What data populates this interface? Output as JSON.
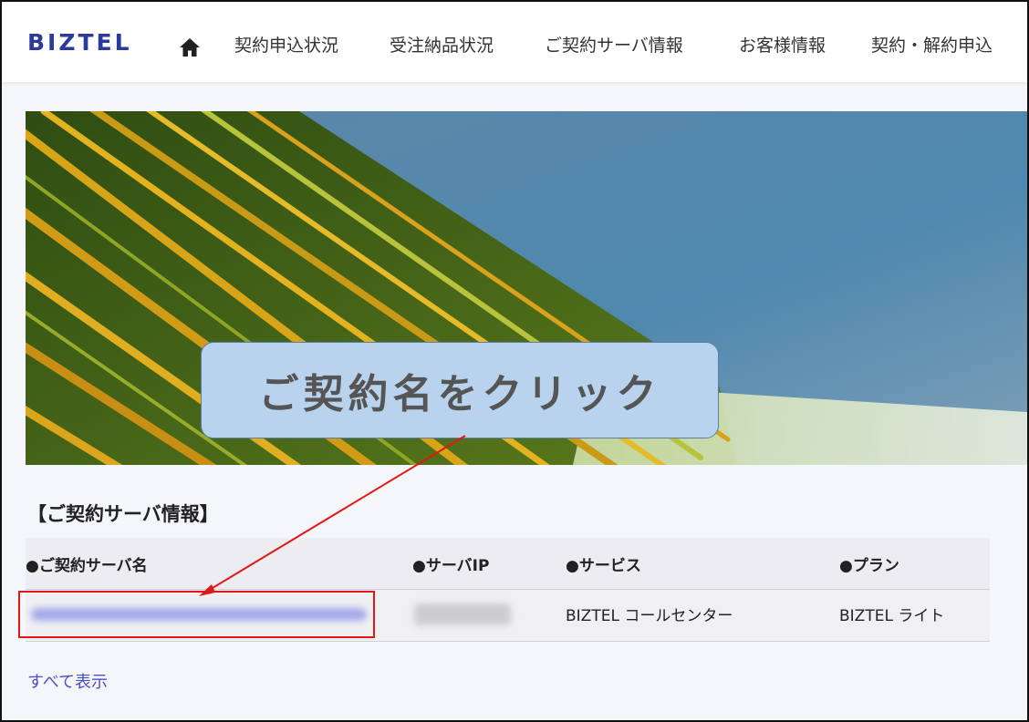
{
  "brand": {
    "logo": "BIZTEL",
    "accent_color": "#2b3a9c"
  },
  "nav": {
    "home_icon": "home-icon",
    "items": [
      {
        "label": "契約申込状況"
      },
      {
        "label": "受注納品状況"
      },
      {
        "label": "ご契約サーバ情報"
      },
      {
        "label": "お客様情報"
      },
      {
        "label": "契約・解約申込"
      }
    ]
  },
  "callout": {
    "text": "ご契約名をクリック",
    "color": "#b9d3ee"
  },
  "section": {
    "title": "【ご契約サーバ情報】",
    "columns": [
      "●ご契約サーバ名",
      "●サーバIP",
      "●サービス",
      "●プラン"
    ],
    "rows": [
      {
        "service": "BIZTEL コールセンター",
        "plan": "BIZTEL ライト"
      }
    ],
    "show_all_label": "すべて表示"
  },
  "annotation": {
    "highlight_color": "#e01818"
  }
}
